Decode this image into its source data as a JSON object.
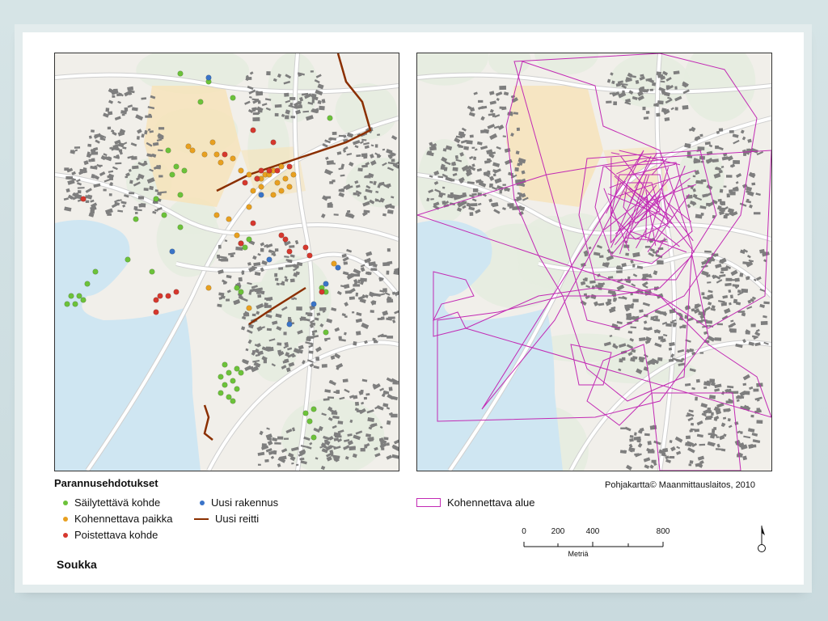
{
  "legend": {
    "title": "Parannusehdotukset",
    "items": [
      {
        "label": "Säilytettävä kohde",
        "color": "#6cc23a",
        "kind": "point"
      },
      {
        "label": "Kohennettava paikka",
        "color": "#e8a020",
        "kind": "point"
      },
      {
        "label": "Poistettava kohde",
        "color": "#d6382e",
        "kind": "point"
      },
      {
        "label": "Uusi rakennus",
        "color": "#3a74c8",
        "kind": "point"
      },
      {
        "label": "Uusi reitti",
        "color": "#8b2f00",
        "kind": "line"
      }
    ],
    "area_item": {
      "label": "Kohennettava alue",
      "color": "#c22ab4",
      "kind": "polygon"
    }
  },
  "credit": "Pohjakartta© Maanmittauslaitos, 2010",
  "place_name": "Soukka",
  "scale": {
    "ticks": [
      "0",
      "200",
      "400",
      "800"
    ],
    "tick_values": [
      0,
      200,
      400,
      800
    ],
    "unit": "Metriä"
  },
  "colors": {
    "water": "#cfe6f2",
    "building": "#7e7e7e",
    "road": "#ffffff",
    "land": "#f1efea",
    "green": "#e6ece0",
    "highlight": "#f7e2b8"
  },
  "icons": {
    "north_arrow": "north-arrow-icon"
  }
}
